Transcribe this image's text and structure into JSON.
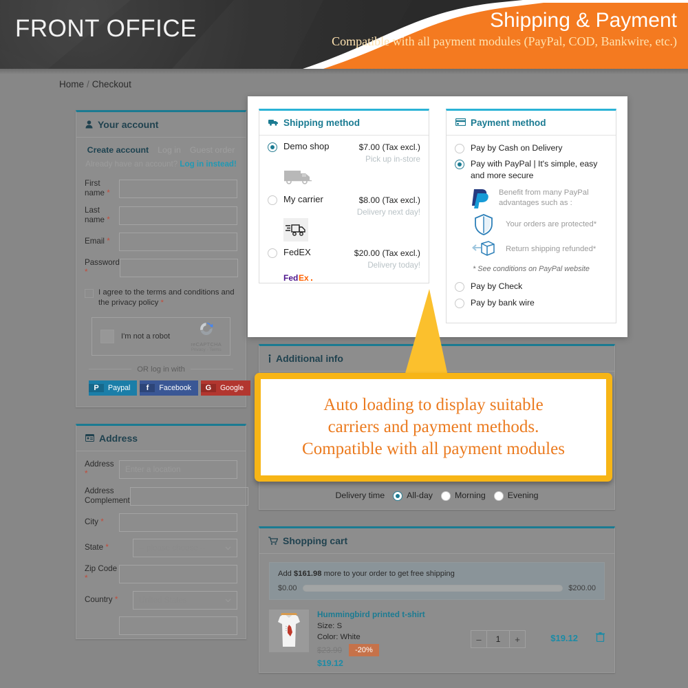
{
  "banner": {
    "left_title": "FRONT OFFICE",
    "right_title": "Shipping & Payment",
    "right_subtitle": "Compatible with all payment modules (PayPal, COD, Bankwire, etc.)",
    "orange": "#f47a20",
    "dark": "#2f2f2f"
  },
  "breadcrumb": {
    "home": "Home",
    "separator": "/",
    "current": "Checkout"
  },
  "account": {
    "icon": "user-icon",
    "title": "Your account",
    "tabs": [
      {
        "label": "Create account",
        "active": true
      },
      {
        "label": "Log in",
        "active": false
      },
      {
        "label": "Guest order",
        "active": false
      }
    ],
    "note_text": "Already have an account?",
    "note_link": "Log in instead!",
    "fields": [
      {
        "label": "First name",
        "required": "*",
        "value": "",
        "placeholder": ""
      },
      {
        "label": "Last name",
        "required": "*",
        "value": "",
        "placeholder": ""
      },
      {
        "label": "Email",
        "required": "*",
        "value": "",
        "placeholder": ""
      },
      {
        "label": "Password",
        "required": "*",
        "value": "",
        "placeholder": ""
      }
    ],
    "agree_text": "I agree to the terms and conditions and the privacy policy",
    "agree_required": "*",
    "captcha": {
      "label": "I'm not a robot",
      "brand": "reCAPTCHA",
      "policy": "Privacy - Terms"
    },
    "or_login": "OR log in with",
    "socials": [
      {
        "name": "Paypal",
        "glyph": "P",
        "bg": "#1b7ea8",
        "glyph_bg": "#17688b"
      },
      {
        "name": "Facebook",
        "glyph": "f",
        "bg": "#3a5795",
        "glyph_bg": "#2d4578"
      },
      {
        "name": "Google",
        "glyph": "G",
        "bg": "#b2362f",
        "glyph_bg": "#952b25"
      }
    ]
  },
  "address": {
    "icon": "address-card-icon",
    "title": "Address",
    "fields": [
      {
        "label": "Address",
        "required": "*",
        "type": "input",
        "value": "",
        "placeholder": "Enter a location"
      },
      {
        "label": "Address Complement",
        "required": "",
        "type": "input",
        "value": "",
        "placeholder": ""
      },
      {
        "label": "City",
        "required": "*",
        "type": "input",
        "value": "",
        "placeholder": ""
      },
      {
        "label": "State",
        "required": "*",
        "type": "select",
        "value": "-- please choose --"
      },
      {
        "label": "Zip Code",
        "required": "*",
        "type": "input",
        "value": "",
        "placeholder": ""
      },
      {
        "label": "Country",
        "required": "*",
        "type": "select",
        "value": "United States"
      }
    ]
  },
  "shipping": {
    "icon": "truck-icon",
    "title": "Shipping method",
    "options": [
      {
        "name": "Demo shop",
        "price": "$7.00 (Tax excl.)",
        "delay": "Pick up in-store",
        "selected": true,
        "logo": "grey-truck-icon"
      },
      {
        "name": "My carrier",
        "price": "$8.00 (Tax excl.)",
        "delay": "Delivery next day!",
        "selected": false,
        "logo": "outline-truck-icon"
      },
      {
        "name": "FedEX",
        "price": "$20.00 (Tax excl.)",
        "delay": "Delivery today!",
        "selected": false,
        "logo": "fedex-logo"
      }
    ]
  },
  "payment": {
    "icon": "credit-card-icon",
    "title": "Payment method",
    "options": [
      {
        "label": "Pay by Cash on Delivery",
        "selected": false
      },
      {
        "label": "Pay with PayPal | It's simple, easy and more secure",
        "selected": true
      },
      {
        "label": "Pay by Check",
        "selected": false
      },
      {
        "label": "Pay by bank wire",
        "selected": false
      }
    ],
    "benefits": [
      {
        "icon": "paypal-logo",
        "text": "Benefit from many PayPal advantages such as :"
      },
      {
        "icon": "shield-icon",
        "text": "Your orders are protected*"
      },
      {
        "icon": "return-box-icon",
        "text": "Return shipping refunded*"
      }
    ],
    "conditions": "* See conditions on PayPal website"
  },
  "additional_info": {
    "icon": "info-icon",
    "title": "Additional info",
    "delivery_time_label": "Delivery time",
    "delivery_options": [
      {
        "label": "All-day",
        "selected": true
      },
      {
        "label": "Morning",
        "selected": false
      },
      {
        "label": "Evening",
        "selected": false
      }
    ]
  },
  "cart": {
    "icon": "cart-icon",
    "title": "Shopping cart",
    "free_shipping_prefix": "Add",
    "free_shipping_amount": "$161.98",
    "free_shipping_suffix": "more to your order to get free shipping",
    "progress_min": "$0.00",
    "progress_max": "$200.00",
    "progress_percent": 19,
    "items": [
      {
        "name": "Hummingbird printed t-shirt",
        "size": "Size: S",
        "color": "Color: White",
        "old_price": "$23.90",
        "discount": "-20%",
        "price": "$19.12",
        "qty_minus": "–",
        "qty_value": "1",
        "qty_plus": "+",
        "line_total": "$19.12",
        "remove_icon": "trash-icon"
      }
    ]
  },
  "callout": {
    "line1": "Auto loading to display suitable",
    "line2": "carriers and payment methods.",
    "line3": "Compatible with all payment modules",
    "border_color": "#f7b516",
    "text_color": "#eb7a1e"
  }
}
